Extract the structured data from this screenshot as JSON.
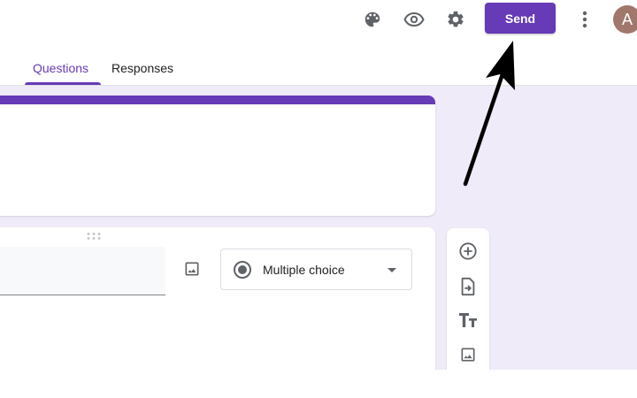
{
  "toolbar": {
    "icons": [
      "palette-icon",
      "eye-icon",
      "gear-icon",
      "more-vert-icon"
    ],
    "send_label": "Send",
    "avatar_initial": "A"
  },
  "tabs": [
    {
      "label": "Questions",
      "active": true
    },
    {
      "label": "Responses",
      "active": false
    }
  ],
  "question": {
    "type_label": "Multiple choice",
    "type_icon": "radio-button-icon"
  },
  "side_toolbar": {
    "icons": [
      "add-circle-icon",
      "import-icon",
      "title-text-icon",
      "image-icon"
    ]
  },
  "colors": {
    "accent": "#673ab7",
    "canvas": "#f0ebf8",
    "avatar": "#a1776b"
  },
  "annotation": {
    "type": "arrow-pointing-to-send-button",
    "color": "#000000"
  }
}
